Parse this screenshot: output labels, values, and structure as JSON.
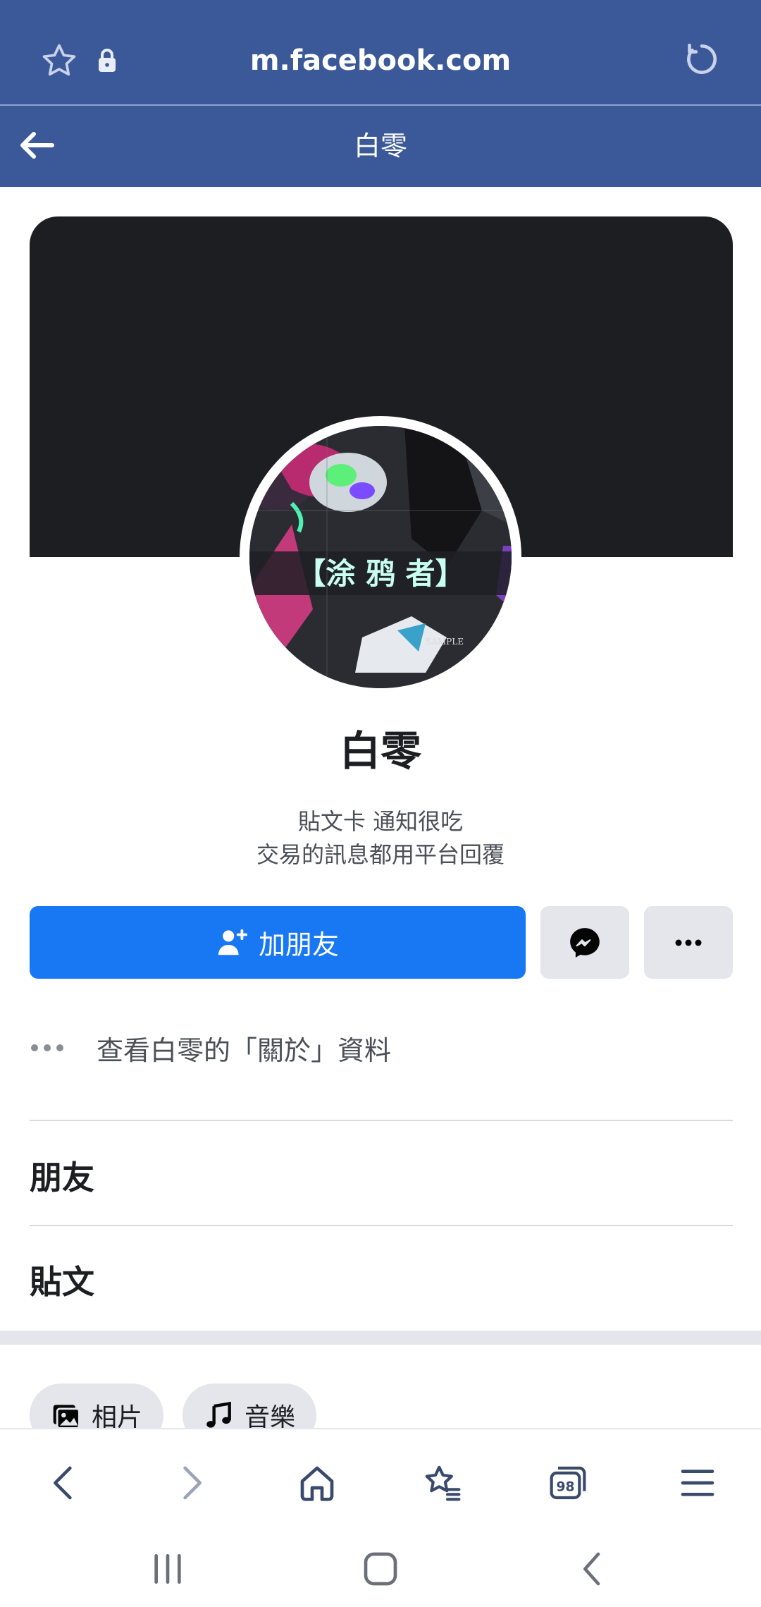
{
  "browser": {
    "url": "m.facebook.com"
  },
  "header": {
    "title": "白零"
  },
  "profile": {
    "name": "白零",
    "bio_line1": "貼文卡 通知很吃",
    "bio_line2": "交易的訊息都用平台回覆",
    "add_friend_label": "加朋友",
    "about_label": "查看白零的「關於」資料",
    "avatar_text": "【涂 鸦 者】",
    "avatar_sample": "SAMPLE"
  },
  "sections": {
    "friends": "朋友",
    "posts": "貼文"
  },
  "chips": {
    "photos": "相片",
    "music": "音樂"
  },
  "tabs_count": "98",
  "colors": {
    "brand": "#3b5998",
    "primary_button": "#1877f2",
    "secondary_button": "#e4e6eb"
  }
}
